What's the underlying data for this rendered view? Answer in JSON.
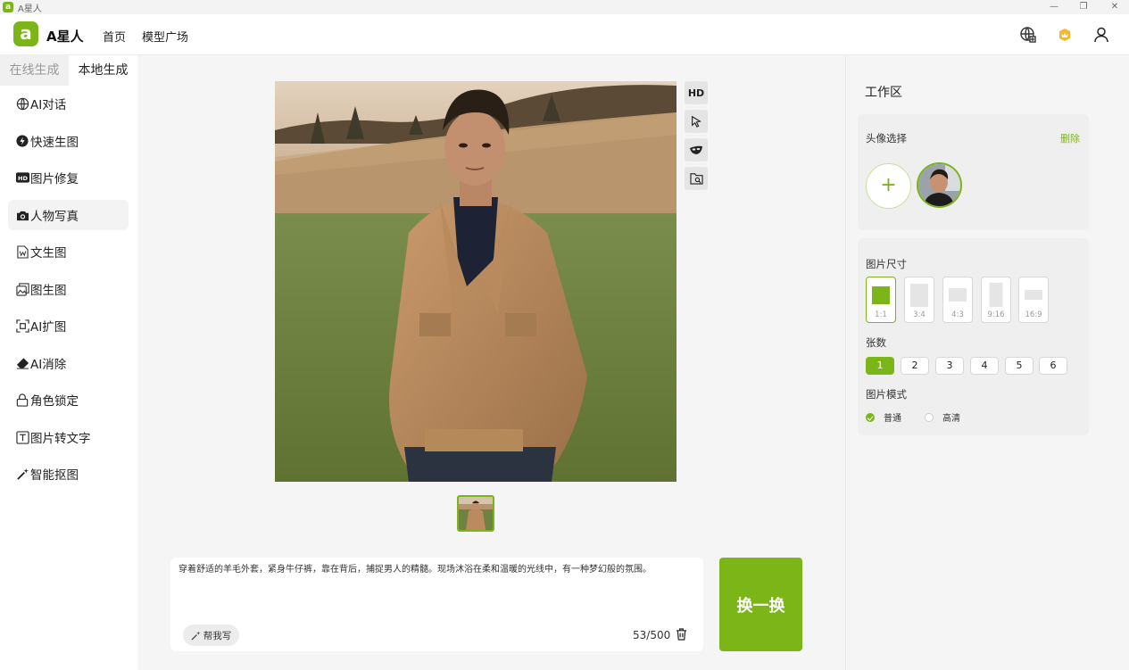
{
  "window": {
    "title": "A星人",
    "app_icon_letter": "a"
  },
  "header": {
    "app_name": "A星人",
    "nav": [
      "首页",
      "模型广场"
    ]
  },
  "sidebar": {
    "tabs": [
      "在线生成",
      "本地生成"
    ],
    "active_tab": "本地生成",
    "items": [
      {
        "label": "AI对话",
        "icon": "globe-icon"
      },
      {
        "label": "快速生图",
        "icon": "bolt-icon"
      },
      {
        "label": "图片修复",
        "icon": "hd-icon"
      },
      {
        "label": "人物写真",
        "icon": "camera-icon"
      },
      {
        "label": "文生图",
        "icon": "word-doc-icon"
      },
      {
        "label": "图生图",
        "icon": "image-stack-icon"
      },
      {
        "label": "AI扩图",
        "icon": "expand-icon"
      },
      {
        "label": "AI消除",
        "icon": "eraser-icon"
      },
      {
        "label": "角色锁定",
        "icon": "lock-icon"
      },
      {
        "label": "图片转文字",
        "icon": "text-box-icon"
      },
      {
        "label": "智能抠图",
        "icon": "magic-wand-icon"
      }
    ],
    "active_item": "人物写真"
  },
  "tools": {
    "hd_label": "HD"
  },
  "prompt": {
    "text": "穿着舒适的羊毛外套，紧身牛仔裤，靠在背后，捕捉男人的精髓。现场沐浴在柔和温暖的光线中，有一种梦幻般的氛围。",
    "help_label": "帮我写",
    "counter": "53/500"
  },
  "generate_label": "换一换",
  "workspace": {
    "title": "工作区",
    "avatar_section": {
      "label": "头像选择",
      "delete_label": "删除",
      "add_symbol": "+"
    },
    "size_section": {
      "label": "图片尺寸",
      "ratios": [
        "1:1",
        "3:4",
        "4:3",
        "9:16",
        "16:9"
      ],
      "selected": "1:1"
    },
    "count_section": {
      "label": "张数",
      "options": [
        "1",
        "2",
        "3",
        "4",
        "5",
        "6"
      ],
      "selected": "1"
    },
    "mode_section": {
      "label": "图片模式",
      "options": [
        "普通",
        "高清"
      ],
      "selected": "普通"
    }
  },
  "colors": {
    "accent": "#7cb518"
  }
}
